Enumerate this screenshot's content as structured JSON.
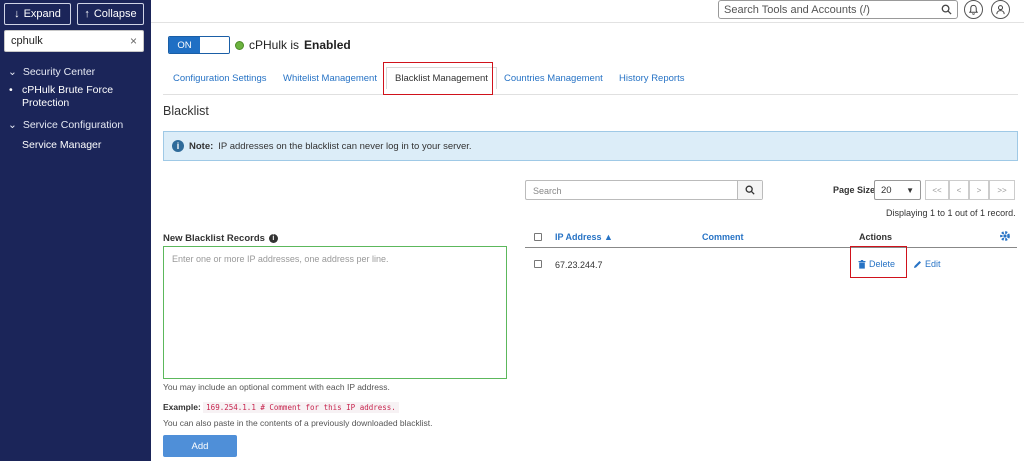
{
  "sidebar": {
    "expand_label": "Expand",
    "collapse_label": "Collapse",
    "filter_value": "cphulk",
    "groups": [
      {
        "label": "Security Center",
        "items": [
          {
            "label": "cPHulk Brute Force",
            "label2": "Protection"
          }
        ]
      },
      {
        "label": "Service Configuration",
        "items": [
          {
            "label": "Service Manager"
          }
        ]
      }
    ]
  },
  "topbar": {
    "search_placeholder": "Search Tools and Accounts (/)"
  },
  "status": {
    "toggle_label": "ON",
    "text_prefix": "cPHulk is",
    "text_state": "Enabled"
  },
  "tabs": [
    {
      "label": "Configuration Settings"
    },
    {
      "label": "Whitelist Management"
    },
    {
      "label": "Blacklist Management"
    },
    {
      "label": "Countries Management"
    },
    {
      "label": "History Reports"
    }
  ],
  "section": {
    "title": "Blacklist",
    "note_bold": "Note:",
    "note_text": "IP addresses on the blacklist can never log in to your server."
  },
  "form": {
    "label": "New Blacklist Records",
    "placeholder": "Enter one or more IP addresses, one address per line.",
    "hint1": "You may include an optional comment with each IP address.",
    "example_label": "Example:",
    "example_code": "169.254.1.1 # Comment for this IP address.",
    "hint2": "You can also paste in the contents of a previously downloaded blacklist.",
    "add_label": "Add"
  },
  "table": {
    "search_placeholder": "Search",
    "page_size_label": "Page Size",
    "page_size_value": "20",
    "pager": [
      "<<",
      "<",
      ">",
      ">>"
    ],
    "display_text": "Displaying 1 to 1 out of 1 record.",
    "columns": {
      "ip": "IP Address ▲",
      "comment": "Comment",
      "actions": "Actions"
    },
    "rows": [
      {
        "ip": "67.23.244.7",
        "comment": "",
        "delete_label": "Delete",
        "edit_label": "Edit"
      }
    ]
  }
}
